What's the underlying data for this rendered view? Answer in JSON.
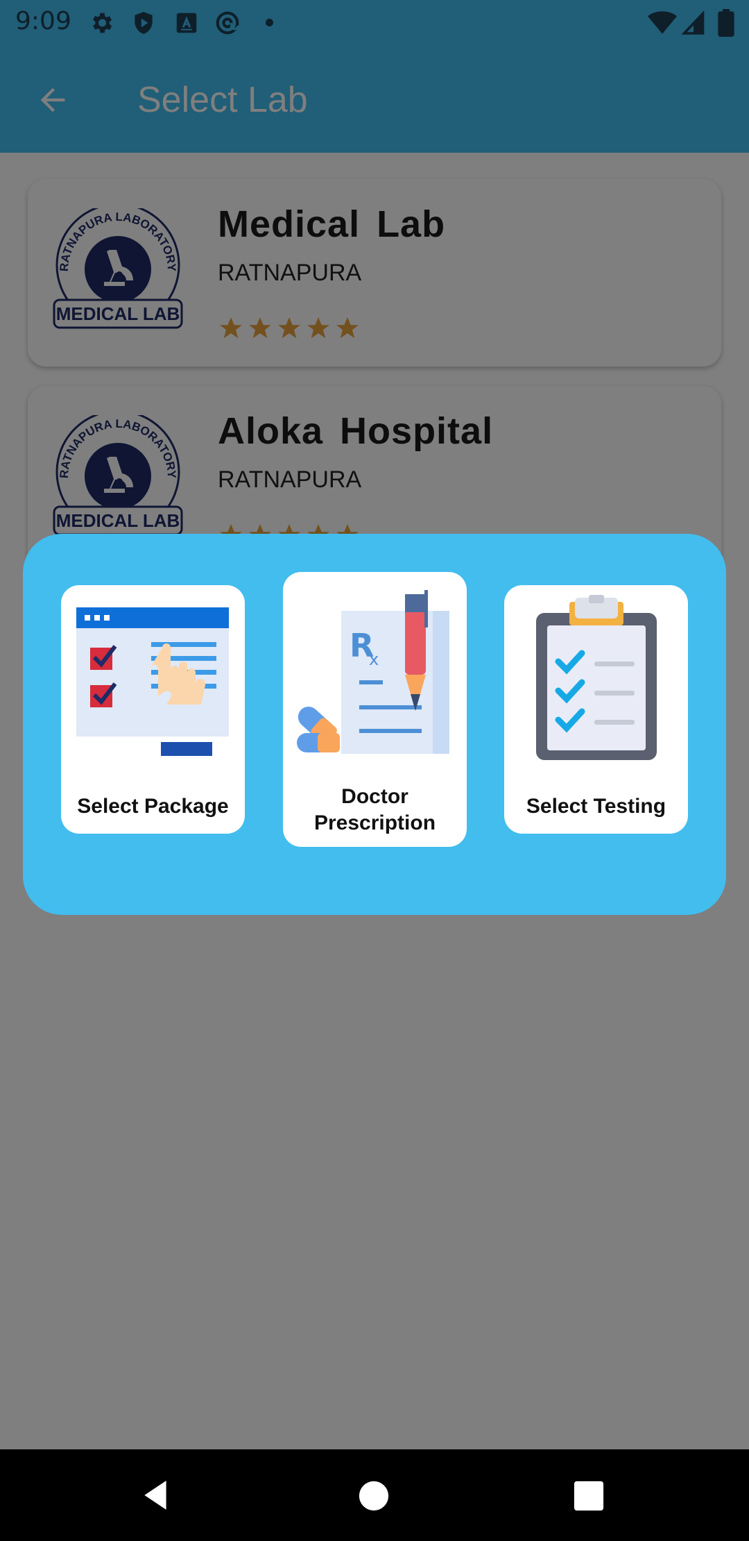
{
  "status_bar": {
    "time": "9:09",
    "icons": [
      "gear-icon",
      "shield-play-icon",
      "text-a-icon",
      "at-sync-icon",
      "dot-icon",
      "wifi-icon",
      "signal-icon",
      "battery-icon"
    ],
    "color": "#42bdee"
  },
  "app_bar": {
    "title": "Select Lab",
    "back_icon": "arrow-back-icon",
    "color": "#42bdee"
  },
  "labs": [
    {
      "name": "Medical Lab",
      "city": "RATNAPURA",
      "rating": 5,
      "logo_text_top": "RATNAPURA LABORATORY",
      "logo_text_bottom": "MEDICAL LAB"
    },
    {
      "name": "Aloka Hospital",
      "city": "RATNAPURA",
      "rating": 5,
      "logo_text_top": "RATNAPURA LABORATORY",
      "logo_text_bottom": "MEDICAL LAB"
    }
  ],
  "dialog": {
    "background": "#42bdee",
    "options": [
      {
        "label": "Select Package",
        "icon": "checklist-touch-icon"
      },
      {
        "label_line1": "Doctor",
        "label_line2": "Prescription",
        "icon": "prescription-icon"
      },
      {
        "label": "Select Testing",
        "icon": "clipboard-check-icon"
      }
    ]
  },
  "colors": {
    "star": "#e6a23c",
    "logo_navy": "#1f2a66",
    "accent": "#42bdee"
  },
  "nav_bar": {
    "icons": [
      "nav-back-icon",
      "nav-home-icon",
      "nav-recents-icon"
    ]
  }
}
